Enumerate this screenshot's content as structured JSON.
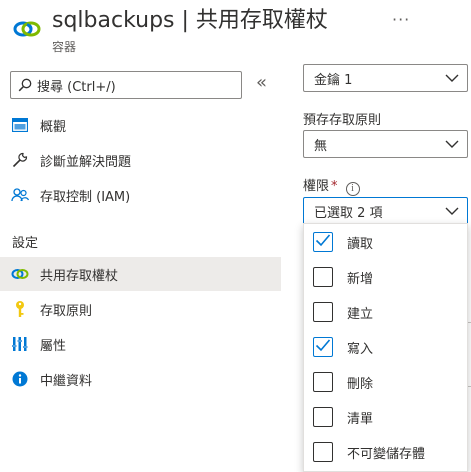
{
  "header": {
    "title": "sqlbackups | 共用存取權杖",
    "subtitle": "容器",
    "more": "···"
  },
  "search": {
    "placeholder": "搜尋 (Ctrl+/)",
    "collapse": "«"
  },
  "nav": {
    "items_top": [
      {
        "label": "概觀",
        "icon": "overview-icon"
      },
      {
        "label": "診斷並解決問題",
        "icon": "wrench-icon"
      },
      {
        "label": "存取控制 (IAM)",
        "icon": "people-icon"
      }
    ],
    "section": "設定",
    "items_settings": [
      {
        "label": "共用存取權杖",
        "icon": "link-icon",
        "selected": true
      },
      {
        "label": "存取原則",
        "icon": "key-icon"
      },
      {
        "label": "屬性",
        "icon": "properties-icon"
      },
      {
        "label": "中繼資料",
        "icon": "info-icon"
      }
    ]
  },
  "form": {
    "key_value": "金鑰 1",
    "policy_label": "預存存取原則",
    "policy_value": "無",
    "permissions_label": "權限",
    "required_mark": "*",
    "permissions_value": "已選取 2 項",
    "info_glyph": "i"
  },
  "permissions_options": [
    {
      "label": "讀取",
      "checked": true
    },
    {
      "label": "新增",
      "checked": false
    },
    {
      "label": "建立",
      "checked": false
    },
    {
      "label": "寫入",
      "checked": true
    },
    {
      "label": "刪除",
      "checked": false
    },
    {
      "label": "清單",
      "checked": false
    },
    {
      "label": "不可變儲存體",
      "checked": false
    }
  ],
  "colors": {
    "accent": "#0078d4",
    "selected_bg": "#edebe9",
    "required": "#a4262c",
    "key_yellow": "#f2c811"
  }
}
